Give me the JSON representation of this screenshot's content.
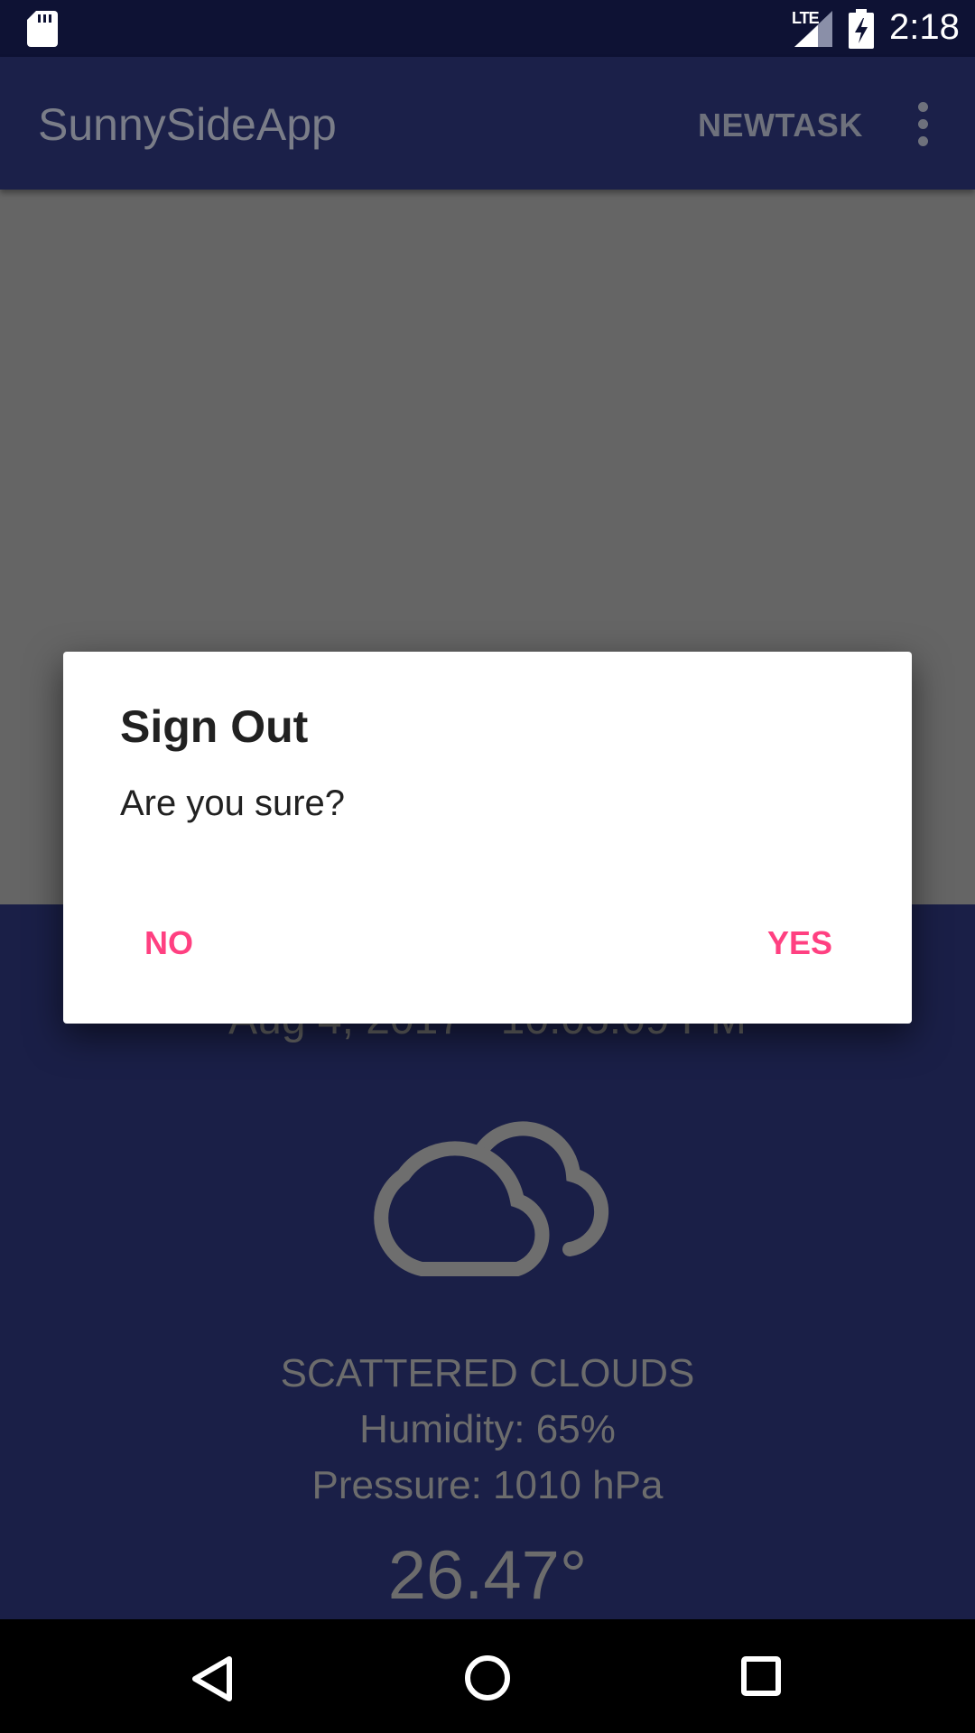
{
  "status_bar": {
    "time": "2:18",
    "network_label": "LTE"
  },
  "app_bar": {
    "title": "SunnySideApp",
    "action_label": "NEWTASK"
  },
  "weather": {
    "date_time": "Aug 4, 2017 - 10:05:09 PM",
    "condition": "SCATTERED CLOUDS",
    "humidity": "Humidity: 65%",
    "pressure": "Pressure: 1010 hPa",
    "temperature": "26.47°"
  },
  "dialog": {
    "title": "Sign Out",
    "message": "Are you sure?",
    "negative_label": "NO",
    "positive_label": "YES"
  },
  "colors": {
    "status_bar": "#0e1234",
    "app_bar": "#1b2049",
    "weather_background": "#1a1f47",
    "scrim_area": "#656565",
    "dialog_button": "#ff4081"
  },
  "icons": {
    "status": [
      "sd-card-icon",
      "signal-icon",
      "battery-charging-icon"
    ],
    "app_bar": [
      "more-vert-icon"
    ],
    "weather": "scattered-clouds-icon",
    "nav": [
      "back-icon",
      "home-icon",
      "recents-icon"
    ]
  }
}
